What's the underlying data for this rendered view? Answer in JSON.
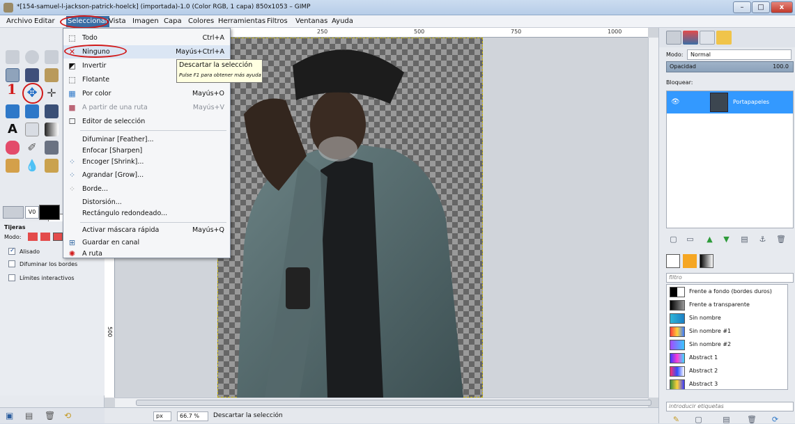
{
  "window": {
    "title": "*[154-samuel-l-jackson-patrick-hoelck] (importada)-1.0 (Color RGB, 1 capa) 850x1053 – GIMP",
    "minimize": "–",
    "maximize": "□",
    "close": "x"
  },
  "menubar": [
    "Archivo",
    "Editar",
    "Seleccionar",
    "Vista",
    "Imagen",
    "Capa",
    "Colores",
    "Herramientas",
    "Filtros",
    "Ventanas",
    "Ayuda"
  ],
  "annotation_number": "1",
  "ruler": {
    "marks": [
      "250",
      "500",
      "750",
      "1000"
    ],
    "left_mark": "500"
  },
  "select_menu": [
    {
      "label": "Todo",
      "shortcut": "Ctrl+A",
      "icon": "⬚"
    },
    {
      "label": "Ninguno",
      "shortcut": "Mayús+Ctrl+A",
      "icon": "✕"
    },
    {
      "label": "Invertir",
      "shortcut": "",
      "icon": "◩"
    },
    {
      "label": "Flotante",
      "shortcut": "",
      "icon": "⬚"
    },
    {
      "label": "Por color",
      "shortcut": "Mayús+O",
      "icon": "▦"
    },
    {
      "label": "A partir de una ruta",
      "shortcut": "Mayús+V",
      "icon": "■"
    },
    {
      "label": "Editor de selección",
      "shortcut": "",
      "icon": "☐"
    },
    {
      "label": "Difuminar [Feather]...",
      "shortcut": "",
      "icon": ""
    },
    {
      "label": "Enfocar [Sharpen]",
      "shortcut": "",
      "icon": ""
    },
    {
      "label": "Encoger [Shrink]...",
      "shortcut": "",
      "icon": "⁘"
    },
    {
      "label": "Agrandar [Grow]...",
      "shortcut": "",
      "icon": "⁘"
    },
    {
      "label": "Borde...",
      "shortcut": "",
      "icon": "⁘"
    },
    {
      "label": "Distorsión...",
      "shortcut": "",
      "icon": ""
    },
    {
      "label": "Rectángulo redondeado...",
      "shortcut": "",
      "icon": ""
    },
    {
      "label": "Activar máscara rápida",
      "shortcut": "Mayús+Q",
      "icon": ""
    },
    {
      "label": "Guardar en canal",
      "shortcut": "",
      "icon": "⊞"
    },
    {
      "label": "A ruta",
      "shortcut": "",
      "icon": "✺"
    }
  ],
  "tooltip": {
    "main": "Descartar la selección",
    "sub": "Pulse F1 para obtener más ayuda"
  },
  "tool_options": {
    "title": "Tijeras",
    "mode_label": "Modo:",
    "antialias": "Alisado",
    "feather": "Difuminar los bordes",
    "interactive": "Límites interactivos"
  },
  "status": {
    "unit": "px",
    "zoom": "66.7 %",
    "message": "Descartar la selección"
  },
  "layers": {
    "mode_label": "Modo:",
    "mode_value": "Normal",
    "opacity_label": "Opacidad",
    "opacity_value": "100.0",
    "lock_label": "Bloquear:",
    "layer_name": "Portapapeles"
  },
  "gradients": {
    "filter_placeholder": "filtro",
    "items": [
      "Frente a fondo (bordes duros)",
      "Frente a transparente",
      "Sin nombre",
      "Sin nombre #1",
      "Sin nombre #2",
      "Abstract 1",
      "Abstract 2",
      "Abstract 3"
    ],
    "tags_placeholder": "introducir etiquetas"
  },
  "colors": {
    "accent": "#3399ff",
    "annotation": "#d11a1a"
  }
}
